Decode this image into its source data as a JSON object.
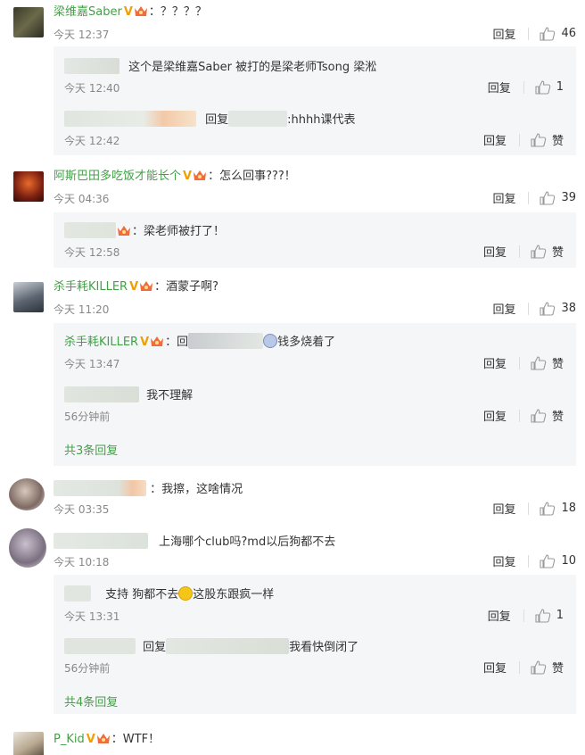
{
  "comments": [
    {
      "username": "梁维嘉Saber",
      "text": "：？？？？",
      "time": "今天 12:37",
      "reply_label": "回复",
      "likes": "46",
      "replies": [
        {
          "text": "这个是梁维嘉Saber  被打的是梁老师Tsong 梁淞",
          "time": "今天 12:40",
          "reply_label": "回复",
          "likes": "1"
        },
        {
          "prefix": "回复",
          "text": ":hhhh课代表",
          "time": "今天 12:42",
          "reply_label": "回复",
          "likes": "赞"
        }
      ]
    },
    {
      "username": "阿斯巴田多吃饭才能长个",
      "text": "：怎么回事???！",
      "time": "今天 04:36",
      "reply_label": "回复",
      "likes": "39",
      "replies": [
        {
          "text": "：梁老师被打了！",
          "time": "今天 12:58",
          "reply_label": "回复",
          "likes": "赞"
        }
      ]
    },
    {
      "username": "杀手耗KILLER",
      "text": "：酒蒙子啊?",
      "time": "今天 11:20",
      "reply_label": "回复",
      "likes": "38",
      "replies": [
        {
          "username": "杀手耗KILLER",
          "prefix": "：回",
          "text": "钱多烧着了",
          "time": "今天 13:47",
          "reply_label": "回复",
          "likes": "赞"
        },
        {
          "text": "我不理解",
          "time": "56分钟前",
          "reply_label": "回复",
          "likes": "赞"
        }
      ],
      "more_label": "共3条回复"
    },
    {
      "text": "：我擦，这啥情况",
      "time": "今天 03:35",
      "reply_label": "回复",
      "likes": "18"
    },
    {
      "text": "上海哪个club吗?md以后狗都不去",
      "time": "今天 10:18",
      "reply_label": "回复",
      "likes": "10",
      "replies": [
        {
          "text": "支持 狗都不去",
          "text2": "这股东跟疯一样",
          "time": "今天 13:31",
          "reply_label": "回复",
          "likes": "1"
        },
        {
          "prefix": "回复",
          "text": "我看快倒闭了",
          "time": "56分钟前",
          "reply_label": "回复",
          "likes": "赞"
        }
      ],
      "more_label": "共4条回复"
    },
    {
      "username": "P_Kid",
      "text": "：WTF！"
    }
  ],
  "colors": {
    "username": "#43a047",
    "vbadge": "#f0a000",
    "reply_bg": "#f5f6f8"
  },
  "icons": {
    "like": "thumbs-up-icon",
    "crown": "crown-badge-icon",
    "verified": "v-verified-icon"
  }
}
